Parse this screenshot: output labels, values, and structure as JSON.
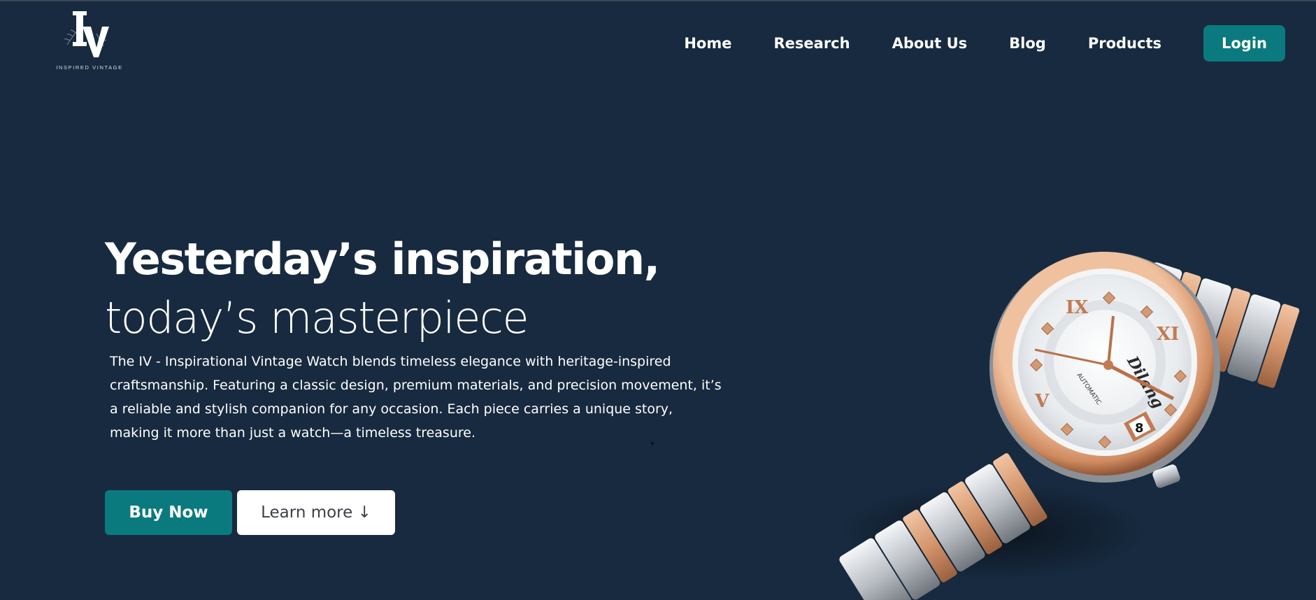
{
  "brand": {
    "logo_text": "IV",
    "caption": "INSPIRED VINTAGE"
  },
  "nav": {
    "items": [
      "Home",
      "Research",
      "About Us",
      "Blog",
      "Products"
    ],
    "login_label": "Login"
  },
  "hero": {
    "title": "Yesterday’s inspiration,",
    "subtitle": "today’s masterpiece",
    "description": "The IV - Inspirational Vintage Watch blends timeless elegance with heritage-inspired craftsmanship. Featuring a classic design, premium materials, and precision movement, it’s a reliable and stylish companion for any occasion. Each piece carries a unique story, making it more than just a watch—a timeless treasure.",
    "buy_label": "Buy Now",
    "learn_label": "Learn more ↓"
  },
  "watch_image": {
    "brand_text": "Dilang",
    "dial_text": "AUTOMATIC",
    "date_value": "8"
  },
  "colors": {
    "background": "#172a3f",
    "accent": "#0b7a7e",
    "text": "#ffffff",
    "secondary_button_bg": "#ffffff",
    "secondary_button_text": "#3b4048",
    "rose_gold": "#d4956c"
  }
}
